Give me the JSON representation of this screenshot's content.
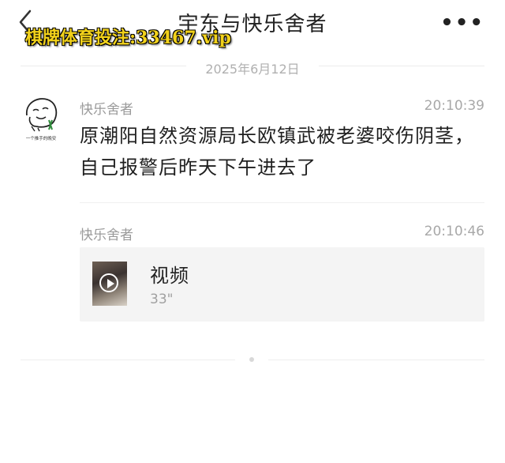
{
  "header": {
    "title": "宇东与快乐舍者",
    "more_label": "•••",
    "back_icon": "chevron-left-icon"
  },
  "watermark": {
    "text": "棋牌体育投注:33467.vip",
    "color": "#f2d21b"
  },
  "date_divider": "2025年6月12日",
  "messages": [
    {
      "sender": "快乐舍者",
      "time": "20:10:39",
      "text": "原潮阳自然资源局长欧镇武被老婆咬伤阴茎，自己报警后昨天下午进去了"
    },
    {
      "sender": "快乐舍者",
      "time": "20:10:46",
      "video": {
        "title": "视频",
        "duration": "33\"",
        "icon": "play-icon"
      }
    }
  ],
  "avatar": {
    "caption": "一个推手的晚安"
  }
}
